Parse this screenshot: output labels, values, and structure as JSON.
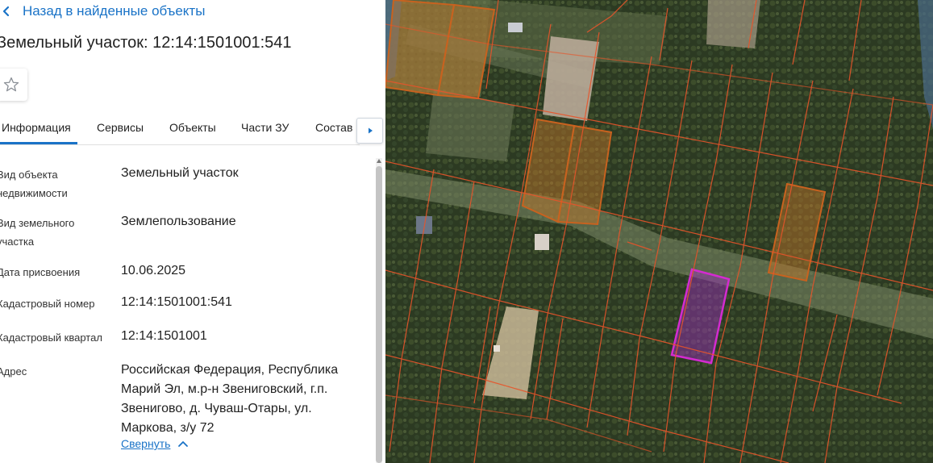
{
  "panel": {
    "back_label": "Назад в найденные объекты",
    "title": "Земельный участок: 12:14:1501001:541",
    "tabs": [
      {
        "label": "Информация"
      },
      {
        "label": "Сервисы"
      },
      {
        "label": "Объекты"
      },
      {
        "label": "Части ЗУ"
      },
      {
        "label": "Состав"
      }
    ],
    "fields": [
      {
        "label": "Вид объекта недвижимости",
        "value": "Земельный участок"
      },
      {
        "label": "Вид земельного участка",
        "value": "Землепользование"
      },
      {
        "label": "Дата присвоения",
        "value": "10.06.2025"
      },
      {
        "label": "Кадастровый номер",
        "value": "12:14:1501001:541"
      },
      {
        "label": "Кадастровый квартал",
        "value": "12:14:1501001"
      },
      {
        "label": "Адрес",
        "value": "Российская Федерация, Республика Марий Эл, м.р-н Звениговский, г.п. Звенигово, д. Чуваш-Отары, ул. Маркова, з/у 72"
      }
    ],
    "collapse_label": "Свернуть"
  },
  "colors": {
    "accent": "#1a73c7",
    "parcel_border": "#e8542a",
    "highlight_border": "#d42bd0",
    "selected_fill": "#c8782a"
  }
}
